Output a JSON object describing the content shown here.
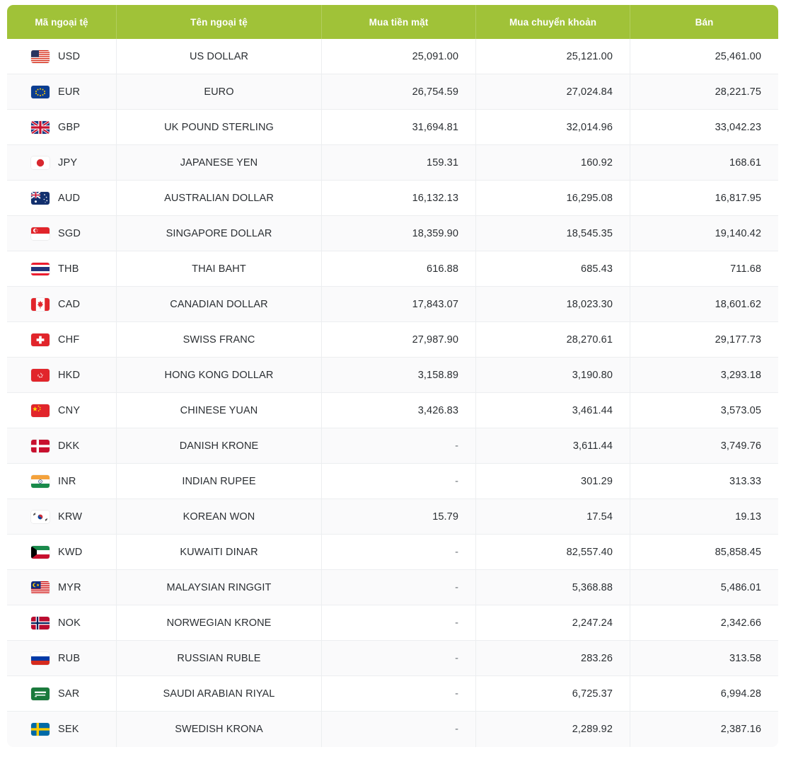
{
  "table": {
    "headers": [
      "Mã ngoại tệ",
      "Tên ngoại tệ",
      "Mua tiền mặt",
      "Mua chuyển khoản",
      "Bán"
    ],
    "header_bg": "#a0c238",
    "header_text_color": "#ffffff",
    "rows": [
      {
        "flag": "flag-us-icon",
        "code": "USD",
        "name": "US DOLLAR",
        "cash": "25,091.00",
        "transfer": "25,121.00",
        "sell": "25,461.00"
      },
      {
        "flag": "flag-eu-icon",
        "code": "EUR",
        "name": "EURO",
        "cash": "26,754.59",
        "transfer": "27,024.84",
        "sell": "28,221.75"
      },
      {
        "flag": "flag-gb-icon",
        "code": "GBP",
        "name": "UK POUND STERLING",
        "cash": "31,694.81",
        "transfer": "32,014.96",
        "sell": "33,042.23"
      },
      {
        "flag": "flag-jp-icon",
        "code": "JPY",
        "name": "JAPANESE YEN",
        "cash": "159.31",
        "transfer": "160.92",
        "sell": "168.61"
      },
      {
        "flag": "flag-au-icon",
        "code": "AUD",
        "name": "AUSTRALIAN DOLLAR",
        "cash": "16,132.13",
        "transfer": "16,295.08",
        "sell": "16,817.95"
      },
      {
        "flag": "flag-sg-icon",
        "code": "SGD",
        "name": "SINGAPORE DOLLAR",
        "cash": "18,359.90",
        "transfer": "18,545.35",
        "sell": "19,140.42"
      },
      {
        "flag": "flag-th-icon",
        "code": "THB",
        "name": "THAI BAHT",
        "cash": "616.88",
        "transfer": "685.43",
        "sell": "711.68"
      },
      {
        "flag": "flag-ca-icon",
        "code": "CAD",
        "name": "CANADIAN DOLLAR",
        "cash": "17,843.07",
        "transfer": "18,023.30",
        "sell": "18,601.62"
      },
      {
        "flag": "flag-ch-icon",
        "code": "CHF",
        "name": "SWISS FRANC",
        "cash": "27,987.90",
        "transfer": "28,270.61",
        "sell": "29,177.73"
      },
      {
        "flag": "flag-hk-icon",
        "code": "HKD",
        "name": "HONG KONG DOLLAR",
        "cash": "3,158.89",
        "transfer": "3,190.80",
        "sell": "3,293.18"
      },
      {
        "flag": "flag-cn-icon",
        "code": "CNY",
        "name": "CHINESE YUAN",
        "cash": "3,426.83",
        "transfer": "3,461.44",
        "sell": "3,573.05"
      },
      {
        "flag": "flag-dk-icon",
        "code": "DKK",
        "name": "DANISH KRONE",
        "cash": "-",
        "transfer": "3,611.44",
        "sell": "3,749.76"
      },
      {
        "flag": "flag-in-icon",
        "code": "INR",
        "name": "INDIAN RUPEE",
        "cash": "-",
        "transfer": "301.29",
        "sell": "313.33"
      },
      {
        "flag": "flag-kr-icon",
        "code": "KRW",
        "name": "KOREAN WON",
        "cash": "15.79",
        "transfer": "17.54",
        "sell": "19.13"
      },
      {
        "flag": "flag-kw-icon",
        "code": "KWD",
        "name": "KUWAITI DINAR",
        "cash": "-",
        "transfer": "82,557.40",
        "sell": "85,858.45"
      },
      {
        "flag": "flag-my-icon",
        "code": "MYR",
        "name": "MALAYSIAN RINGGIT",
        "cash": "-",
        "transfer": "5,368.88",
        "sell": "5,486.01"
      },
      {
        "flag": "flag-no-icon",
        "code": "NOK",
        "name": "NORWEGIAN KRONE",
        "cash": "-",
        "transfer": "2,247.24",
        "sell": "2,342.66"
      },
      {
        "flag": "flag-ru-icon",
        "code": "RUB",
        "name": "RUSSIAN RUBLE",
        "cash": "-",
        "transfer": "283.26",
        "sell": "313.58"
      },
      {
        "flag": "flag-sa-icon",
        "code": "SAR",
        "name": "SAUDI ARABIAN RIYAL",
        "cash": "-",
        "transfer": "6,725.37",
        "sell": "6,994.28"
      },
      {
        "flag": "flag-se-icon",
        "code": "SEK",
        "name": "SWEDISH KRONA",
        "cash": "-",
        "transfer": "2,289.92",
        "sell": "2,387.16"
      }
    ]
  }
}
